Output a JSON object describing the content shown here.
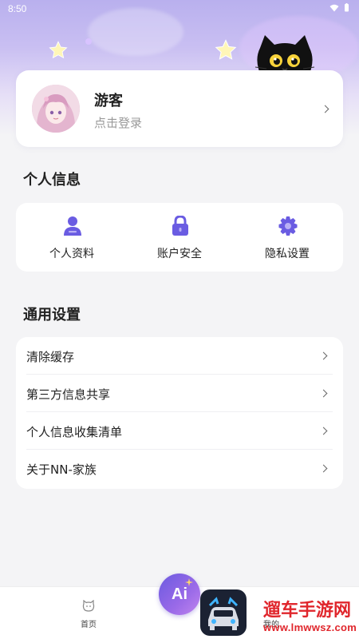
{
  "status": {
    "time": "8:50"
  },
  "profile": {
    "name": "游客",
    "login_hint": "点击登录"
  },
  "personal_info": {
    "title": "个人信息",
    "items": [
      {
        "label": "个人资料",
        "icon": "person-icon"
      },
      {
        "label": "账户安全",
        "icon": "lock-icon"
      },
      {
        "label": "隐私设置",
        "icon": "gear-icon"
      }
    ]
  },
  "general_settings": {
    "title": "通用设置",
    "items": [
      {
        "label": "清除缓存"
      },
      {
        "label": "第三方信息共享"
      },
      {
        "label": "个人信息收集清单"
      },
      {
        "label": "关于NN-家族"
      }
    ]
  },
  "tabbar": {
    "home_label": "首页",
    "ai_label": "Ai",
    "mine_label": "我的"
  },
  "watermark": {
    "name": "遛车手游网",
    "url": "www.lmwwsz.com"
  },
  "colors": {
    "accent": "#6b5ae0",
    "icon_purple": "#6a5ce2",
    "background": "#f4f4f6"
  }
}
